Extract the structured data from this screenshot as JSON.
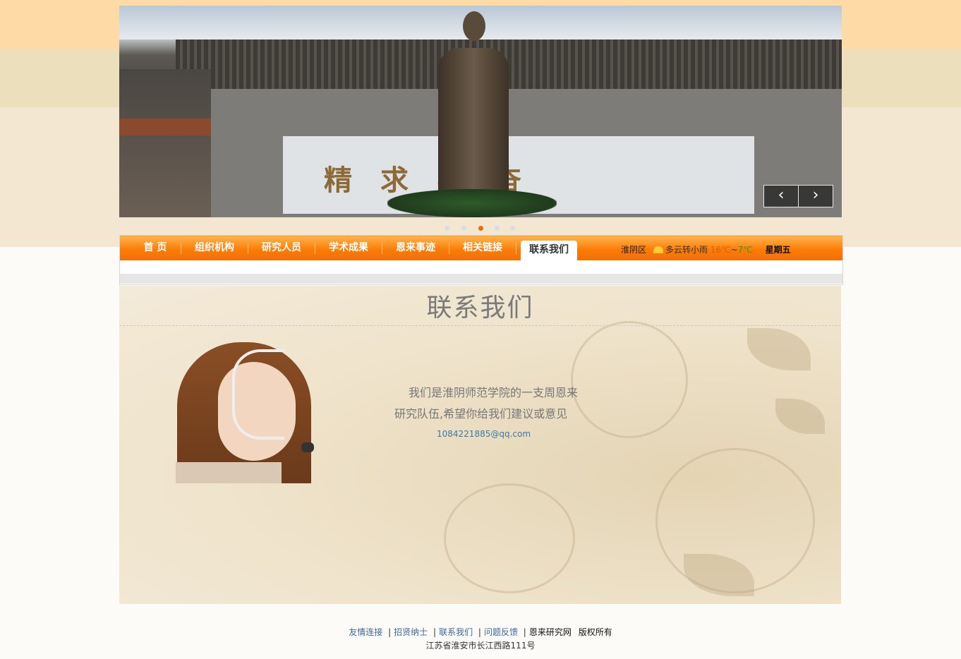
{
  "banner": {
    "plaque_text": "精求学奋",
    "prev_icon": "‹",
    "next_icon": "›"
  },
  "nav": {
    "items": [
      {
        "label": "首 页"
      },
      {
        "label": "组织机构"
      },
      {
        "label": "研究人员"
      },
      {
        "label": "学术成果"
      },
      {
        "label": "恩来事迹"
      },
      {
        "label": "相关链接"
      },
      {
        "label": "联系我们",
        "active": true
      }
    ]
  },
  "weather": {
    "area": "淮阴区",
    "condition": "多云转小雨",
    "high": "16℃",
    "tilde": "~",
    "low": "7℃",
    "weekday": "星期五"
  },
  "content": {
    "title": "联系我们",
    "intro_line1": "我们是淮阴师范学院的一支周恩来",
    "intro_line2": "研究队伍,希望你给我们建议或意见",
    "email": "1084221885@qq.com"
  },
  "footer": {
    "links": [
      "友情连接",
      "招贤纳士",
      "联系我们",
      "问题反馈"
    ],
    "site_name": "恩来研究网",
    "rights": "版权所有",
    "separator": "|",
    "address": "江苏省淮安市长江西路111号"
  }
}
